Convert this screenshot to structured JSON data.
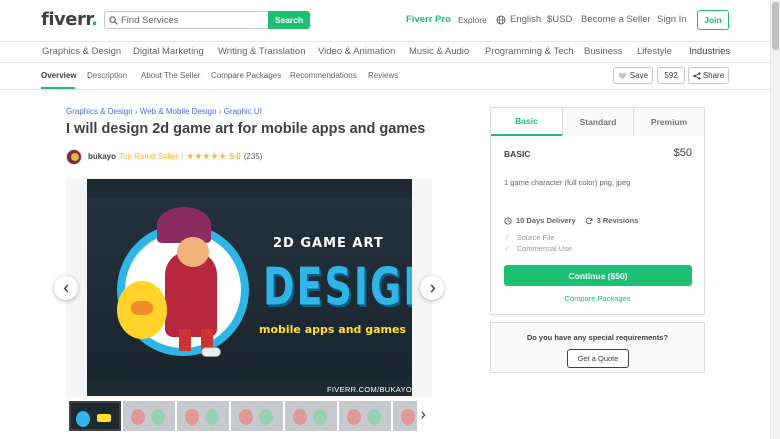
{
  "header": {
    "logo_text": "fiverr",
    "logo_dot": ".",
    "search_placeholder": "Find Services",
    "search_button": "Search",
    "nav": {
      "pro": "Fiverr Pro",
      "explore": "Explore",
      "language": "English",
      "currency": "$USD",
      "become_seller": "Become a Seller",
      "sign_in": "Sign In",
      "join": "Join"
    }
  },
  "categories": [
    "Graphics & Design",
    "Digital Marketing",
    "Writing & Translation",
    "Video & Animation",
    "Music & Audio",
    "Programming & Tech",
    "Business",
    "Lifestyle",
    "Industries"
  ],
  "subnav": {
    "items": [
      "Overview",
      "Description",
      "About The Seller",
      "Compare Packages",
      "Recommendations",
      "Reviews"
    ],
    "active": "Overview",
    "save_label": "Save",
    "save_count": "592",
    "share_label": "Share"
  },
  "gig": {
    "breadcrumb": "Graphics & Design › Web & Mobile Design › Graphic UI",
    "title": "I will design 2d game art for mobile apps and games",
    "seller": {
      "name": "bukayo",
      "level": "Top Rated Seller",
      "separator": "|",
      "stars": "★★★★★",
      "rating": "5.0",
      "reviews": "(235)"
    },
    "image": {
      "title_line1": "2D GAME ART",
      "title_line2": "DESIGN",
      "subtitle": "mobile apps and games",
      "site": "FIVERR.COM/BUKAYO"
    },
    "thumbnail_count": 7
  },
  "package": {
    "tabs": [
      "Basic",
      "Standard",
      "Premium"
    ],
    "active_tab": "Basic",
    "name": "BASIC",
    "price": "$50",
    "description": "1 game character (full color) png, jpeg",
    "delivery": "10 Days Delivery",
    "revisions": "3 Revisions",
    "features": [
      "Source File",
      "Commercial Use"
    ],
    "continue_button": "Continue ($50)",
    "compare_link": "Compare Packages"
  },
  "requirements": {
    "question": "Do you have any special requirements?",
    "button": "Get a Quote"
  },
  "colors": {
    "brand_green": "#1dbf73",
    "star_gold": "#ffb33e",
    "link_blue": "#446ee7",
    "text_dark": "#404145"
  }
}
